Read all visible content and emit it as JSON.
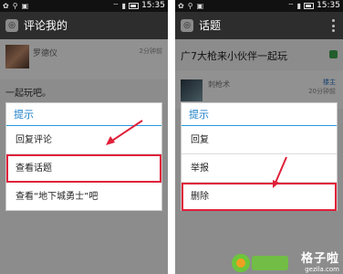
{
  "left": {
    "status": {
      "time": "15:35"
    },
    "title": "评论我的",
    "comment": {
      "name": "罗德仪",
      "time": "2分钟前",
      "body": "一起玩吧。"
    },
    "dialog": {
      "title": "提示",
      "items": [
        "回复评论",
        "查看话题",
        "查看“地下城勇士”吧"
      ]
    }
  },
  "right": {
    "status": {
      "time": "15:35"
    },
    "title": "话题",
    "topic": {
      "title": "广7大枪来小伙伴一起玩",
      "name": "刺枪术",
      "tag": "楼主",
      "time": "20分钟前"
    },
    "dialog": {
      "title": "提示",
      "items": [
        "回复",
        "举报",
        "删除"
      ]
    }
  },
  "watermark": {
    "main": "格子啦",
    "sub": "gezila.com"
  },
  "colors": {
    "accent_blue": "#1a7fc8",
    "highlight_red": "#e0203a",
    "status_bar": "#111111",
    "title_bar": "#2d2d2d"
  }
}
